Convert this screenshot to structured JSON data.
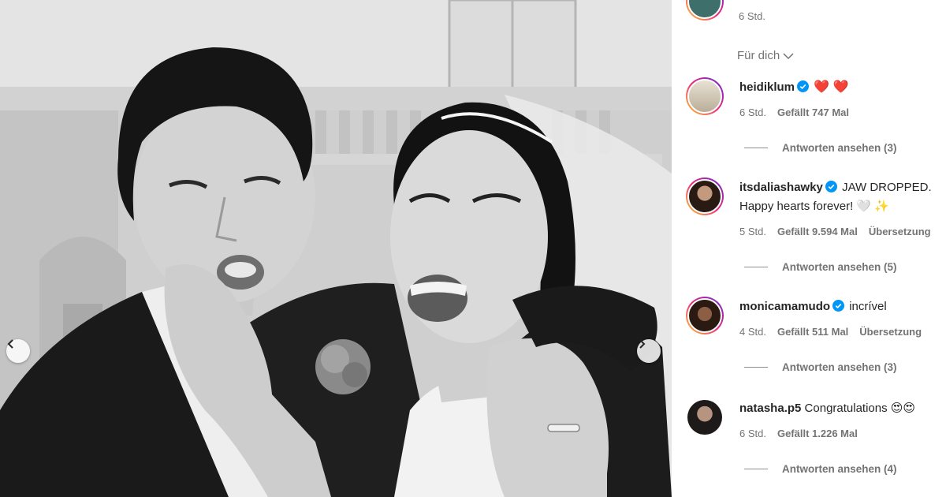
{
  "post": {
    "carousel_prev": "previous",
    "carousel_next": "next"
  },
  "top_comment": {
    "time": "6 Std."
  },
  "sort_label": "Für dich",
  "comments": [
    {
      "username": "heidiklum",
      "verified": true,
      "text": "❤️ ❤️",
      "time": "6 Std.",
      "likes": "Gefällt 747 Mal",
      "translate": "",
      "replies": "Antworten ansehen (3)"
    },
    {
      "username": "itsdaliashawky",
      "verified": true,
      "text": "JAW DROPPED.",
      "text_line2": "Happy hearts forever! 🤍 ✨",
      "time": "5 Std.",
      "likes": "Gefällt 9.594 Mal",
      "translate": "Übersetzung",
      "replies": "Antworten ansehen (5)"
    },
    {
      "username": "monicamamudo",
      "verified": true,
      "text": "incrível",
      "time": "4 Std.",
      "likes": "Gefällt 511 Mal",
      "translate": "Übersetzung",
      "replies": "Antworten ansehen (3)"
    },
    {
      "username": "natasha.p5",
      "verified": false,
      "text": "Congratulations 😍😍",
      "time": "6 Std.",
      "likes": "Gefällt 1.226 Mal",
      "translate": "",
      "replies": "Antworten ansehen (4)"
    }
  ],
  "colors": {
    "text": "#262626",
    "secondary": "#737373",
    "verified": "#0095f6",
    "heart": "#ed1e4d"
  }
}
